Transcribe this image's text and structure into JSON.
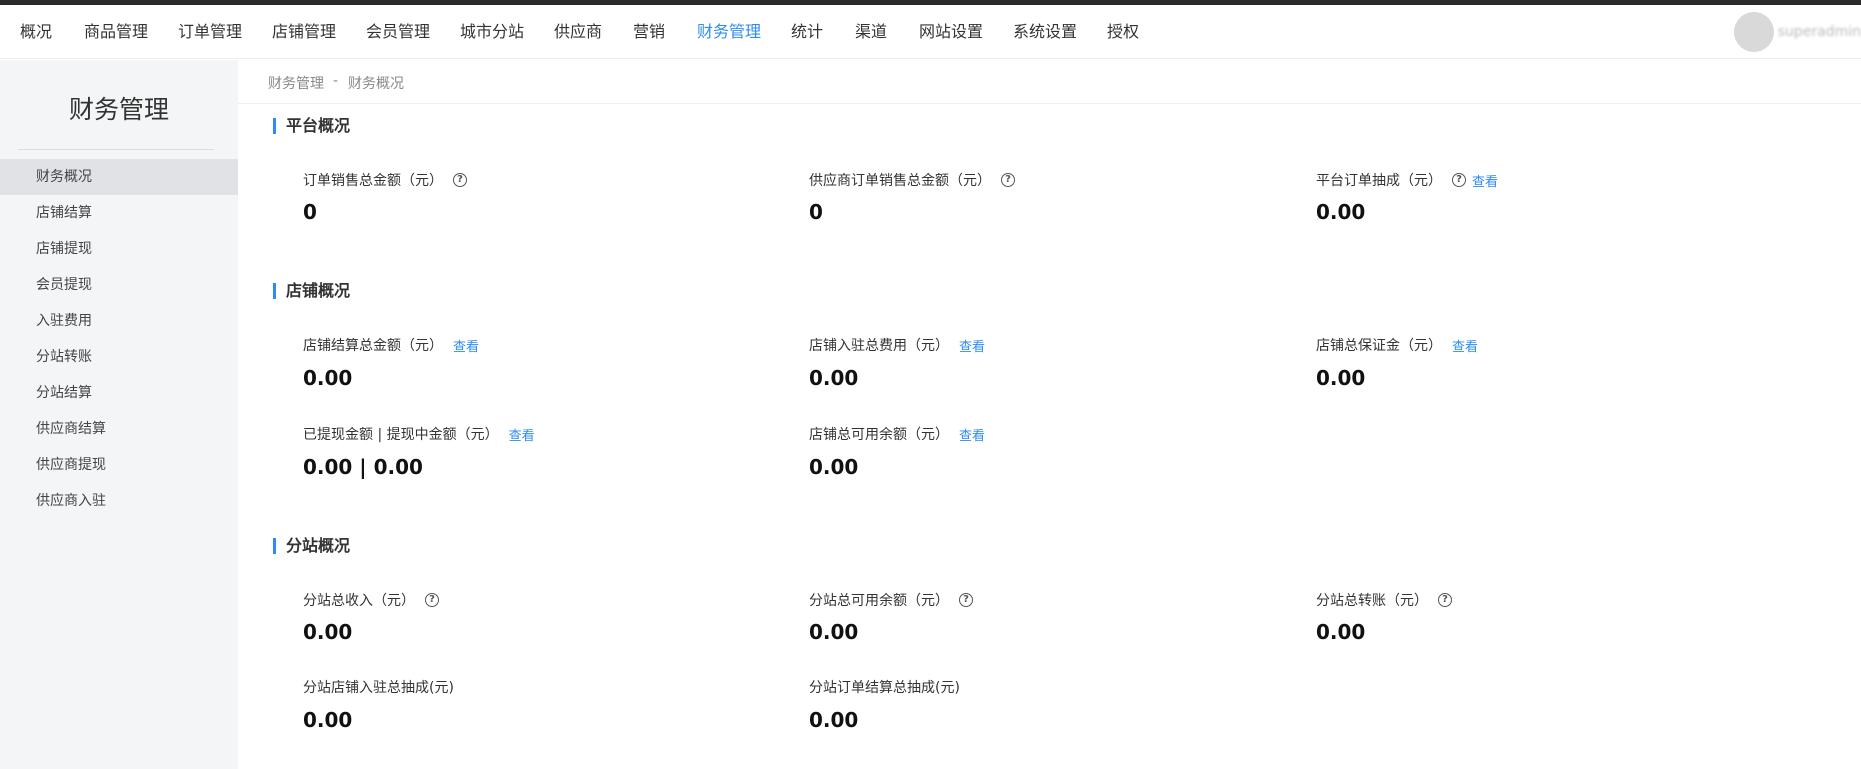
{
  "nav": {
    "items": [
      "概况",
      "商品管理",
      "订单管理",
      "店铺管理",
      "会员管理",
      "城市分站",
      "供应商",
      "营销",
      "财务管理",
      "统计",
      "渠道",
      "网站设置",
      "系统设置",
      "授权"
    ],
    "active": "财务管理",
    "username": "superadmin"
  },
  "sidebar": {
    "title": "财务管理",
    "items": [
      "财务概况",
      "店铺结算",
      "店铺提现",
      "会员提现",
      "入驻费用",
      "分站转账",
      "分站结算",
      "供应商结算",
      "供应商提现",
      "供应商入驻"
    ],
    "active": "财务概况"
  },
  "breadcrumb": {
    "parent": "财务管理",
    "separator": "-",
    "current": "财务概况"
  },
  "common": {
    "view": "查看",
    "help": "?"
  },
  "platform": {
    "title": "平台概况",
    "order_sales_label": "订单销售总金额（元）",
    "order_sales_value": "0",
    "supplier_sales_label": "供应商订单销售总金额（元）",
    "supplier_sales_value": "0",
    "commission_label": "平台订单抽成（元）",
    "commission_value": "0.00"
  },
  "store": {
    "title": "店铺概况",
    "settlement_label": "店铺结算总金额（元）",
    "settlement_value": "0.00",
    "entry_fee_label": "店铺入驻总费用（元）",
    "entry_fee_value": "0.00",
    "deposit_label": "店铺总保证金（元）",
    "deposit_value": "0.00",
    "withdrawn_label": "已提现金额 | 提现中金额（元）",
    "withdrawn_value": "0.00 | 0.00",
    "available_label": "店铺总可用余额（元）",
    "available_value": "0.00"
  },
  "branch": {
    "title": "分站概况",
    "income_label": "分站总收入（元）",
    "income_value": "0.00",
    "available_label": "分站总可用余额（元）",
    "available_value": "0.00",
    "transfer_label": "分站总转账（元）",
    "transfer_value": "0.00",
    "store_entry_label": "分站店铺入驻总抽成(元)",
    "store_entry_value": "0.00",
    "order_settle_label": "分站订单结算总抽成(元)",
    "order_settle_value": "0.00"
  }
}
